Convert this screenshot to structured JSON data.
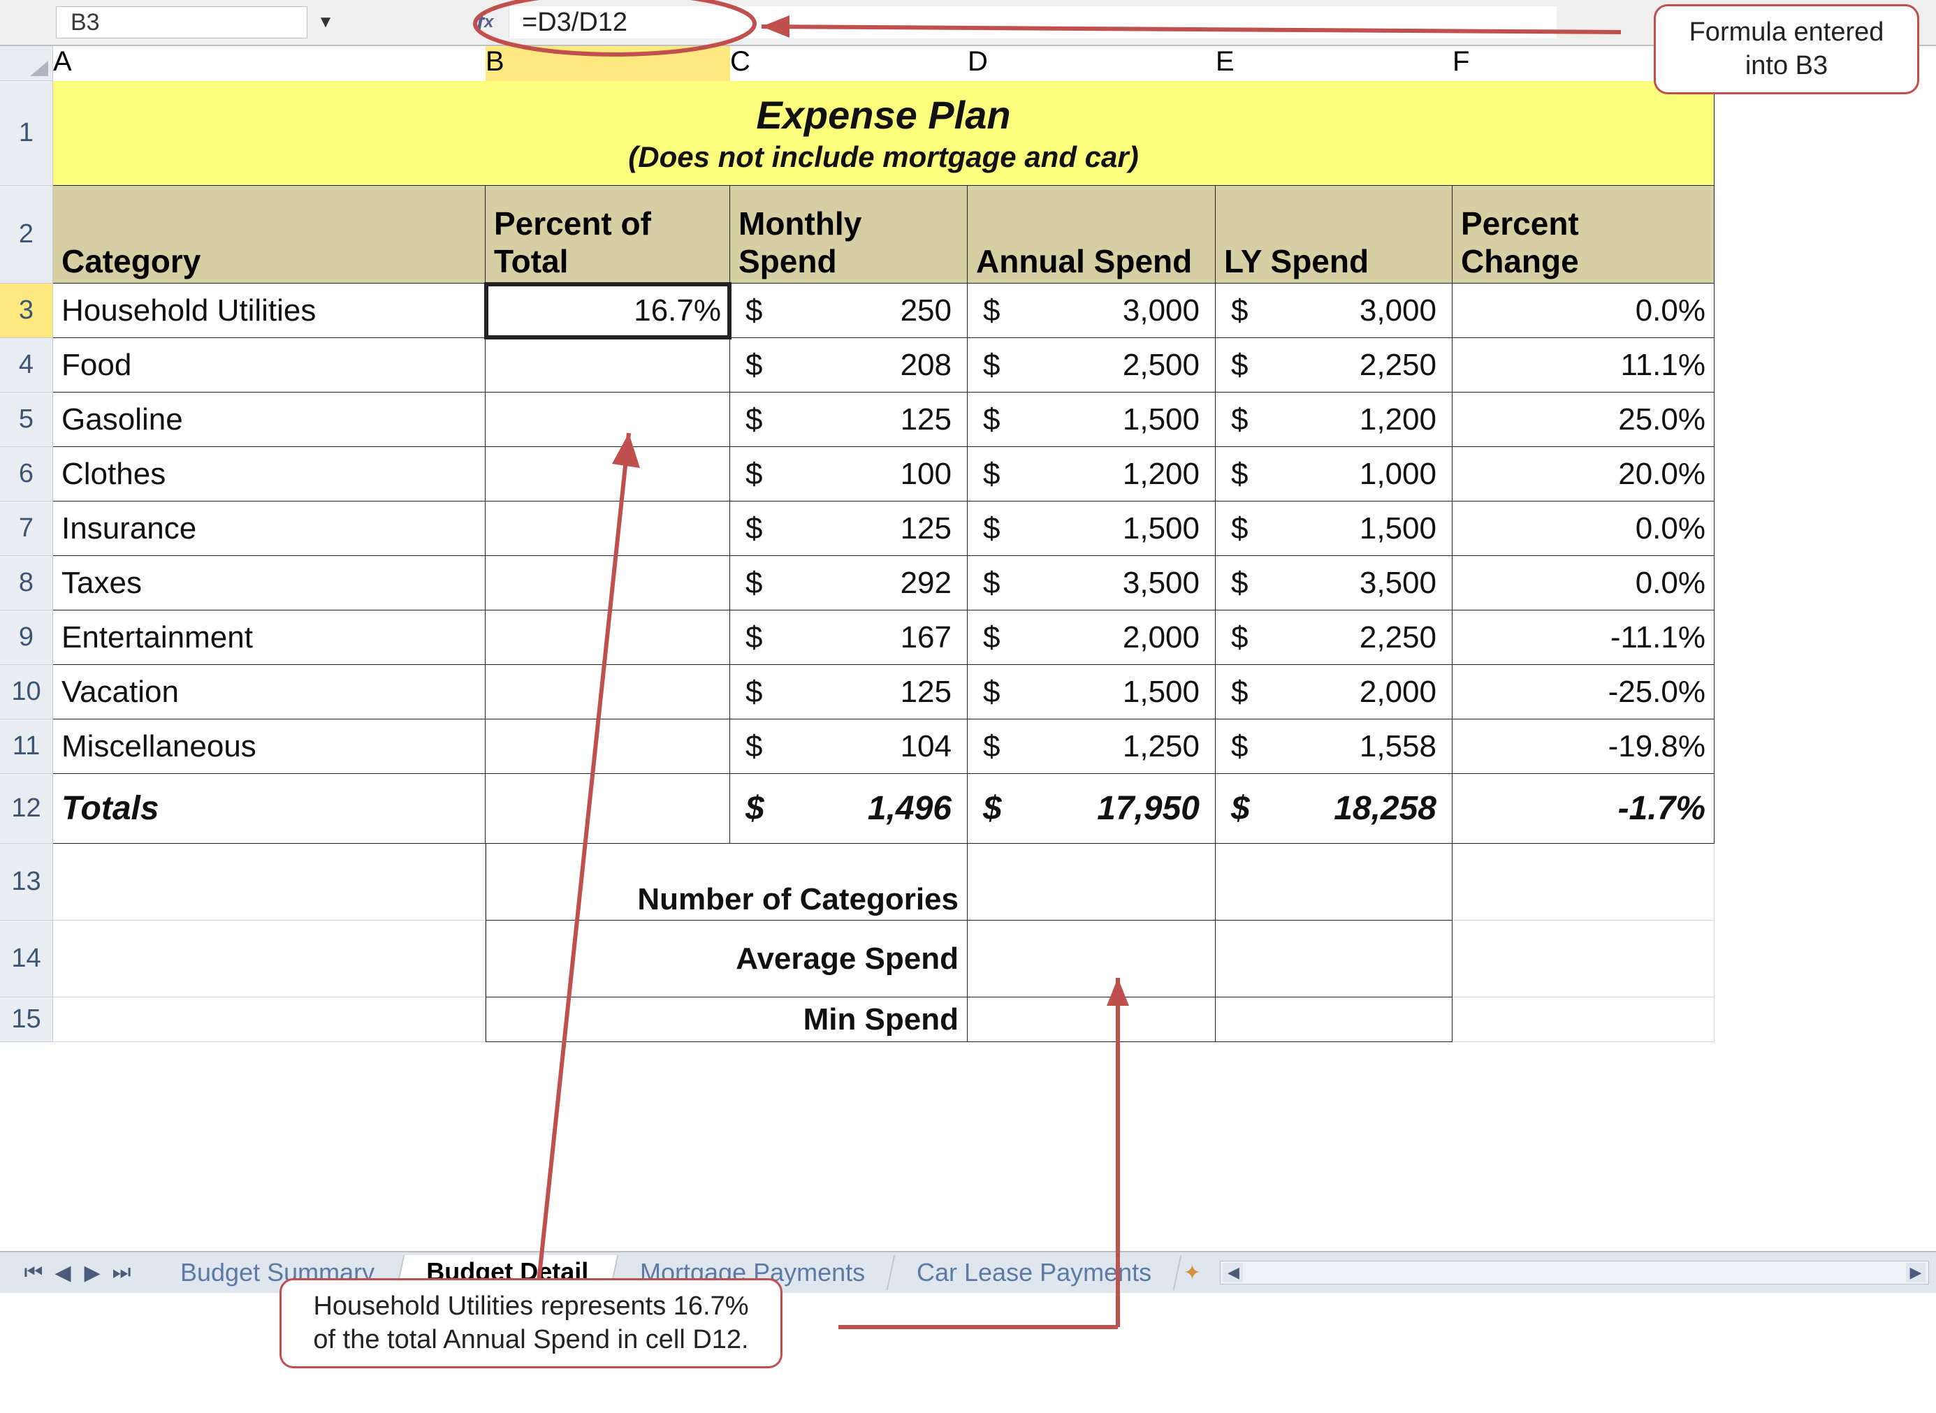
{
  "formula_bar": {
    "cell_ref": "B3",
    "fx_label": "fx",
    "formula": "=D3/D12"
  },
  "columns": [
    "A",
    "B",
    "C",
    "D",
    "E",
    "F"
  ],
  "active_col": "B",
  "active_row": "3",
  "title": {
    "main": "Expense Plan",
    "sub": "(Does not include mortgage and car)"
  },
  "headers": {
    "category": "Category",
    "percent": "Percent of Total",
    "monthly": "Monthly Spend",
    "annual": "Annual Spend",
    "ly": "LY Spend",
    "change": "Percent Change"
  },
  "rows": [
    {
      "n": "3",
      "cat": "Household Utilities",
      "pct": "16.7%",
      "m": "250",
      "a": "3,000",
      "ly": "3,000",
      "ch": "0.0%"
    },
    {
      "n": "4",
      "cat": "Food",
      "pct": "",
      "m": "208",
      "a": "2,500",
      "ly": "2,250",
      "ch": "11.1%"
    },
    {
      "n": "5",
      "cat": "Gasoline",
      "pct": "",
      "m": "125",
      "a": "1,500",
      "ly": "1,200",
      "ch": "25.0%"
    },
    {
      "n": "6",
      "cat": "Clothes",
      "pct": "",
      "m": "100",
      "a": "1,200",
      "ly": "1,000",
      "ch": "20.0%"
    },
    {
      "n": "7",
      "cat": "Insurance",
      "pct": "",
      "m": "125",
      "a": "1,500",
      "ly": "1,500",
      "ch": "0.0%"
    },
    {
      "n": "8",
      "cat": "Taxes",
      "pct": "",
      "m": "292",
      "a": "3,500",
      "ly": "3,500",
      "ch": "0.0%"
    },
    {
      "n": "9",
      "cat": "Entertainment",
      "pct": "",
      "m": "167",
      "a": "2,000",
      "ly": "2,250",
      "ch": "-11.1%"
    },
    {
      "n": "10",
      "cat": "Vacation",
      "pct": "",
      "m": "125",
      "a": "1,500",
      "ly": "2,000",
      "ch": "-25.0%"
    },
    {
      "n": "11",
      "cat": "Miscellaneous",
      "pct": "",
      "m": "104",
      "a": "1,250",
      "ly": "1,558",
      "ch": "-19.8%"
    }
  ],
  "totals": {
    "n": "12",
    "label": "Totals",
    "m": "1,496",
    "a": "17,950",
    "ly": "18,258",
    "ch": "-1.7%"
  },
  "summary": {
    "r13": {
      "n": "13",
      "label": "Number of Categories"
    },
    "r14": {
      "n": "14",
      "label": "Average Spend"
    },
    "r15": {
      "n": "15",
      "label": "Min Spend"
    }
  },
  "tabs": {
    "t1": "Budget Summary",
    "t2": "Budget Detail",
    "t3": "Mortgage Payments",
    "t4": "Car Lease Payments"
  },
  "callouts": {
    "top": "Formula entered into B3",
    "bottom": "Household Utilities represents 16.7% of the total Annual Spend in cell D12."
  },
  "currency": "$"
}
